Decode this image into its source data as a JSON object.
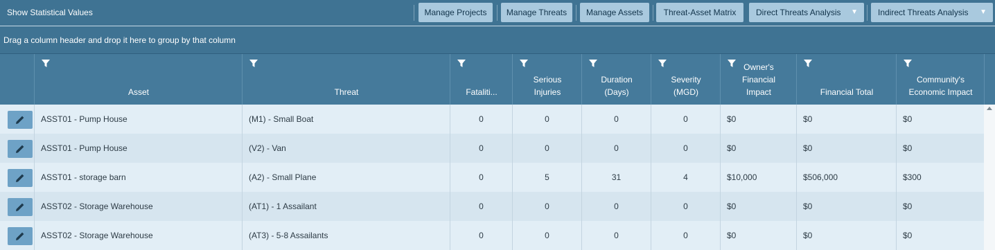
{
  "toolbar": {
    "stat_label": "Show Statistical Values",
    "buttons": {
      "manage_projects": "Manage Projects",
      "manage_threats": "Manage Threats",
      "manage_assets": "Manage Assets",
      "threat_asset_matrix": "Threat-Asset Matrix",
      "direct_threats": "Direct Threats Analysis",
      "indirect_threats": "Indirect Threats Analysis"
    }
  },
  "grouping_hint": "Drag a column header and drop it here to group by that column",
  "columns": {
    "asset": "Asset",
    "threat": "Threat",
    "fatalities": "Fataliti...",
    "serious_1": "Serious",
    "serious_2": "Injuries",
    "duration_1": "Duration",
    "duration_2": "(Days)",
    "severity_1": "Severity",
    "severity_2": "(MGD)",
    "owners_1": "Owner's",
    "owners_2": "Financial",
    "owners_3": "Impact",
    "financial_total": "Financial Total",
    "community_1": "Community's",
    "community_2": "Economic Impact"
  },
  "rows": [
    {
      "asset": "ASST01 - Pump House",
      "threat": "(M1) - Small Boat",
      "fatalities": "0",
      "injuries": "0",
      "duration": "0",
      "severity": "0",
      "owner_impact": "$0",
      "financial_total": "$0",
      "community_impact": "$0"
    },
    {
      "asset": "ASST01 - Pump House",
      "threat": "(V2) - Van",
      "fatalities": "0",
      "injuries": "0",
      "duration": "0",
      "severity": "0",
      "owner_impact": "$0",
      "financial_total": "$0",
      "community_impact": "$0"
    },
    {
      "asset": "ASST01 - storage barn",
      "threat": "(A2) - Small Plane",
      "fatalities": "0",
      "injuries": "5",
      "duration": "31",
      "severity": "4",
      "owner_impact": "$10,000",
      "financial_total": "$506,000",
      "community_impact": "$300"
    },
    {
      "asset": "ASST02 - Storage Warehouse",
      "threat": "(AT1) - 1 Assailant",
      "fatalities": "0",
      "injuries": "0",
      "duration": "0",
      "severity": "0",
      "owner_impact": "$0",
      "financial_total": "$0",
      "community_impact": "$0"
    },
    {
      "asset": "ASST02 - Storage Warehouse",
      "threat": "(AT3) - 5-8 Assailants",
      "fatalities": "0",
      "injuries": "0",
      "duration": "0",
      "severity": "0",
      "owner_impact": "$0",
      "financial_total": "$0",
      "community_impact": "$0"
    }
  ],
  "icons": {
    "filter": "filter-icon",
    "edit": "pencil-icon",
    "dropdown": "caret-down-icon",
    "scroll_up": "scroll-up-arrow-icon"
  },
  "colors": {
    "toolbar_bg": "#3f7393",
    "button_bg": "#a9c9de",
    "header_bg": "#457a9b",
    "row_odd": "#e2eef6",
    "row_even": "#d6e5ef",
    "edit_button": "#6ea2c6"
  }
}
